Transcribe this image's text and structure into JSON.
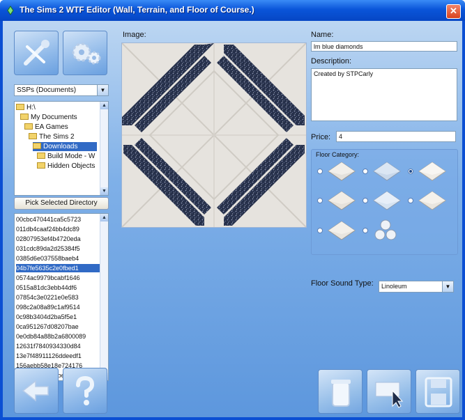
{
  "window": {
    "title": "The Sims 2 WTF Editor (Wall, Terrain, and Floor of Course.)",
    "close_glyph": "✕"
  },
  "sidebar": {
    "drive_combo": "SSPs (Documents)",
    "tree_items": [
      {
        "label": "H:\\",
        "selected": false
      },
      {
        "label": "My Documents",
        "selected": false
      },
      {
        "label": "EA Games",
        "selected": false
      },
      {
        "label": "The Sims 2",
        "selected": false
      },
      {
        "label": "Downloads",
        "selected": true
      },
      {
        "label": "Build Mode - W",
        "selected": false
      },
      {
        "label": "Hidden Objects",
        "selected": false
      }
    ],
    "pick_button": "Pick Selected Directory",
    "files": [
      {
        "name": "00cbc470441ca5c5723",
        "selected": false
      },
      {
        "name": "011db4caaf24bb4dc89",
        "selected": false
      },
      {
        "name": "02807953ef4b4720eda",
        "selected": false
      },
      {
        "name": "031cdc89da2d25384f5",
        "selected": false
      },
      {
        "name": "0385d6e037558baeb4",
        "selected": false
      },
      {
        "name": "04b7fe5635c2e0fbed1",
        "selected": true
      },
      {
        "name": "0574ac9979bcabf1646",
        "selected": false
      },
      {
        "name": "0515a81dc3ebb44df6",
        "selected": false
      },
      {
        "name": "07854c3e0221e0e583",
        "selected": false
      },
      {
        "name": "098c2a08a89c1af9514",
        "selected": false
      },
      {
        "name": "0c98b3404d2ba5f5e1",
        "selected": false
      },
      {
        "name": "0ca951267d08207bae",
        "selected": false
      },
      {
        "name": "0e0db84a88b2a6800089",
        "selected": false
      },
      {
        "name": "12631f7840934330d84",
        "selected": false
      },
      {
        "name": "13e7f48911126ddeedf1",
        "selected": false
      },
      {
        "name": "156aebb58e18e724176",
        "selected": false
      },
      {
        "name": "169426dc8867be28da4",
        "selected": false
      }
    ]
  },
  "image_panel": {
    "label": "Image:"
  },
  "properties": {
    "name_label": "Name:",
    "name_value": "lm blue diamonds",
    "description_label": "Description:",
    "description_value": "Created by STPCarly",
    "price_label": "Price:",
    "price_value": "4",
    "category_label": "Floor Category:",
    "categories_selected_index": 2,
    "sound_label": "Floor Sound Type:",
    "sound_value": "Linoleum"
  },
  "colors": {
    "window_blue": "#0b4fd3",
    "selection": "#316ac5",
    "tile_dark": "#2a3046",
    "tile_light": "#e8e6e2"
  }
}
